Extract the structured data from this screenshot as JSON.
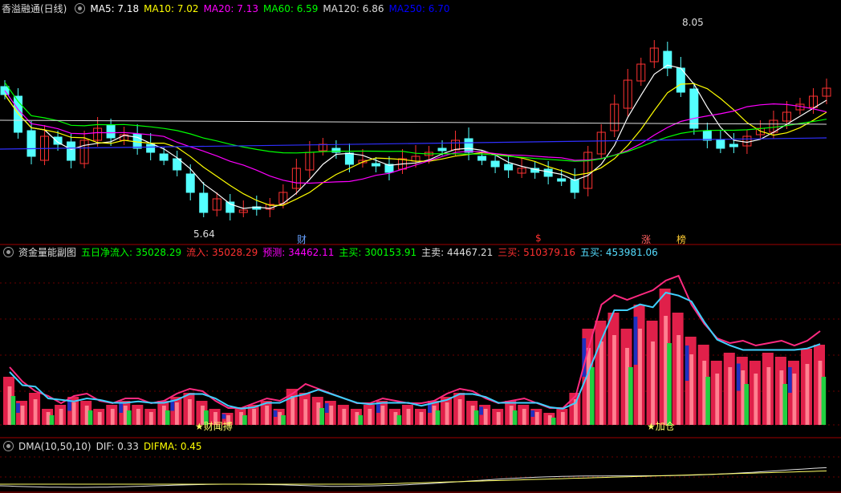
{
  "panel1": {
    "title": "香溢融通(日线)",
    "indicators": [
      {
        "label": "MA5:",
        "value": "7.18",
        "color": "#ffffff"
      },
      {
        "label": "MA10:",
        "value": "7.02",
        "color": "#ffff00"
      },
      {
        "label": "MA20:",
        "value": "7.13",
        "color": "#ff00ff"
      },
      {
        "label": "MA60:",
        "value": "6.59",
        "color": "#00ff00"
      },
      {
        "label": "MA120:",
        "value": "6.86",
        "color": "#dddddd"
      },
      {
        "label": "MA250:",
        "value": "6.70",
        "color": "#0000ff"
      }
    ],
    "high_label": "8.05",
    "low_label": "5.64",
    "markers": [
      {
        "text": "财",
        "color": "#66a0ff"
      },
      {
        "text": "$",
        "color": "#ff3030"
      },
      {
        "text": "涨",
        "color": "#ff6060"
      },
      {
        "text": "榜",
        "color": "#ffcc33"
      }
    ]
  },
  "panel2": {
    "title": "资金量能副图",
    "indicators": [
      {
        "label": "五日净流入:",
        "value": "35028.29",
        "color": "#00ff00"
      },
      {
        "label": "流入:",
        "value": "35028.29",
        "color": "#ff3030"
      },
      {
        "label": "预测:",
        "value": "34462.11",
        "color": "#ff00ff"
      },
      {
        "label": "主买:",
        "value": "300153.91",
        "color": "#00ff00"
      },
      {
        "label": "主卖:",
        "value": "44467.21",
        "color": "#dddddd"
      },
      {
        "label": "三买:",
        "value": "510379.16",
        "color": "#ff3030"
      },
      {
        "label": "五买:",
        "value": "453981.06",
        "color": "#55ddff"
      }
    ],
    "annotations": [
      "★财闻搏",
      "★加仓"
    ]
  },
  "panel3": {
    "title": "DMA(10,50,10)",
    "indicators": [
      {
        "label": "DIF:",
        "value": "0.33",
        "color": "#dddddd"
      },
      {
        "label": "DIFMA:",
        "value": "0.45",
        "color": "#ffff00"
      }
    ]
  },
  "colors": {
    "up": "#ff3232",
    "down": "#54ffff",
    "frame": "#8b0000",
    "grid": "#5a0000"
  }
}
